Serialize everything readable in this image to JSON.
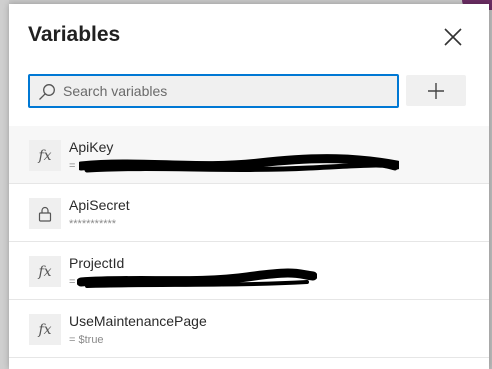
{
  "dialog": {
    "title": "Variables",
    "search": {
      "placeholder": "Search variables"
    }
  },
  "variables": [
    {
      "name": "ApiKey",
      "icon": "fx",
      "value": "= ••••••••••••••••••••••"
    },
    {
      "name": "ApiSecret",
      "icon": "lock",
      "value": "***********"
    },
    {
      "name": "ProjectId",
      "icon": "fx",
      "value": "= ••••••••••••••••••"
    },
    {
      "name": "UseMaintenancePage",
      "icon": "fx",
      "value": "= $true"
    }
  ],
  "colors": {
    "accent": "#0078d4",
    "brand_corner": "#6b2d63"
  }
}
